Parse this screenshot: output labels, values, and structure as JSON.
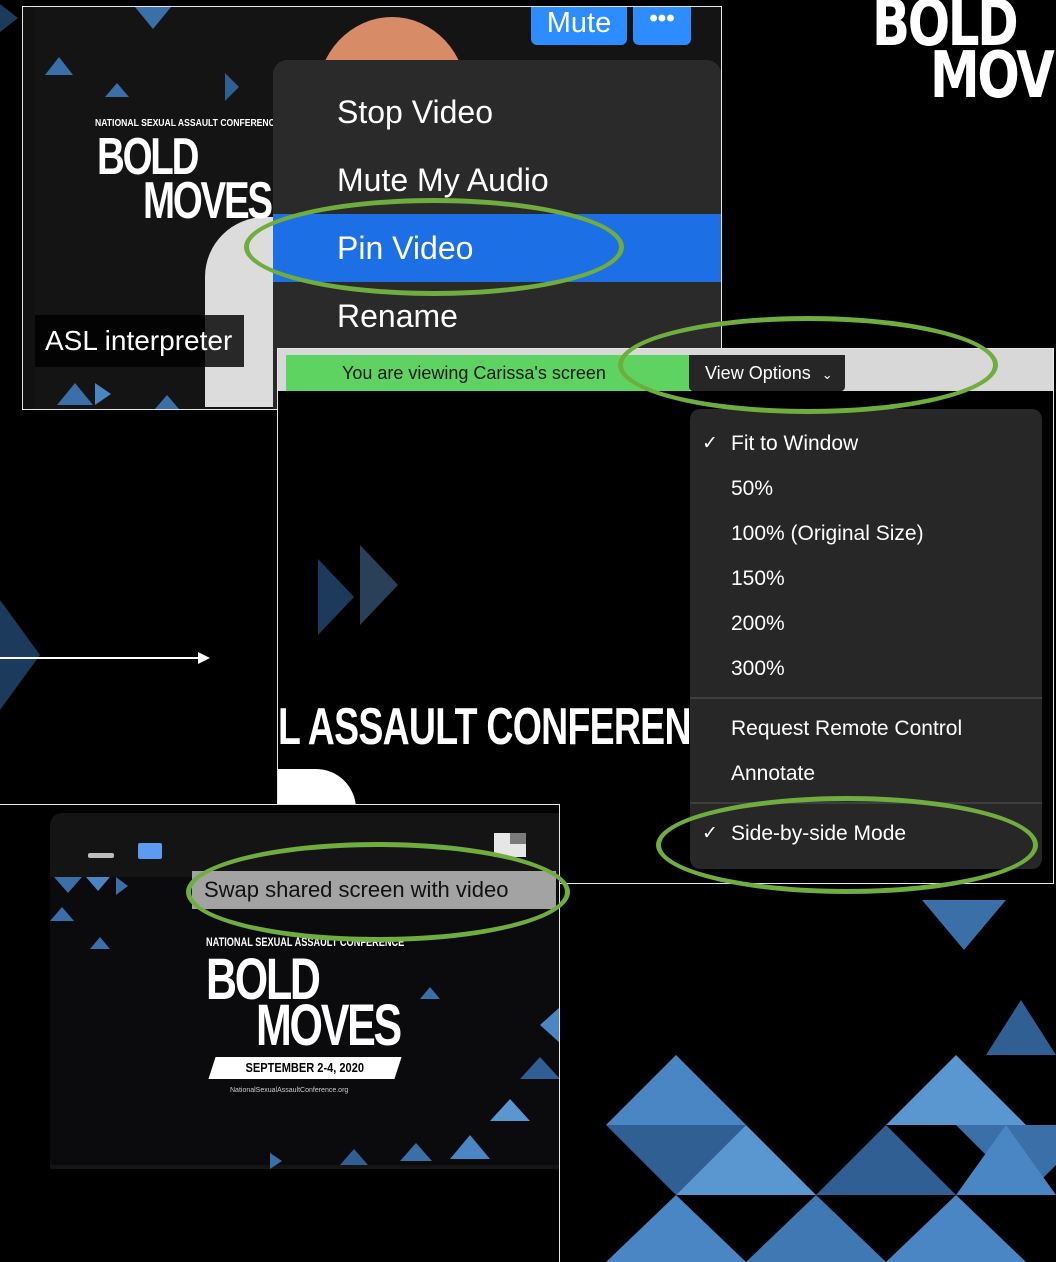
{
  "logo": {
    "word1": "BOLD",
    "word2": "MOVES",
    "subtitle": "NATIONAL SEXUAL ASSAULT CONFERENCE",
    "date": "SEPTEMBER 2-4, 2020",
    "url": "NationalSexualAssaultConference.org"
  },
  "video_tile": {
    "name": "ASL interpreter",
    "mute_label": "Mute",
    "more_label": "•••"
  },
  "context_menu": {
    "items": [
      {
        "label": "Stop Video",
        "selected": false
      },
      {
        "label": "Mute My Audio",
        "selected": false
      },
      {
        "label": "Pin Video",
        "selected": true
      },
      {
        "label": "Rename",
        "selected": false
      }
    ]
  },
  "share_view": {
    "banner": "You are viewing Carissa's screen",
    "view_options_label": "View Options",
    "slide_text": "L ASSAULT CONFERENCE",
    "dropdown": {
      "zoom_items": [
        {
          "label": "Fit to Window",
          "checked": true
        },
        {
          "label": "50%",
          "checked": false
        },
        {
          "label": "100% (Original Size)",
          "checked": false
        },
        {
          "label": "150%",
          "checked": false
        },
        {
          "label": "200%",
          "checked": false
        },
        {
          "label": "300%",
          "checked": false
        }
      ],
      "control_items": [
        {
          "label": "Request Remote Control",
          "checked": false
        },
        {
          "label": "Annotate",
          "checked": false
        }
      ],
      "mode_items": [
        {
          "label": "Side-by-side Mode",
          "checked": true
        }
      ],
      "check_glyph": "✓"
    }
  },
  "swap_panel": {
    "tooltip": "Swap shared screen with video"
  },
  "colors": {
    "highlight": "#6fad3f",
    "zoom_blue": "#2d8cff",
    "banner_green": "#5ed362"
  }
}
